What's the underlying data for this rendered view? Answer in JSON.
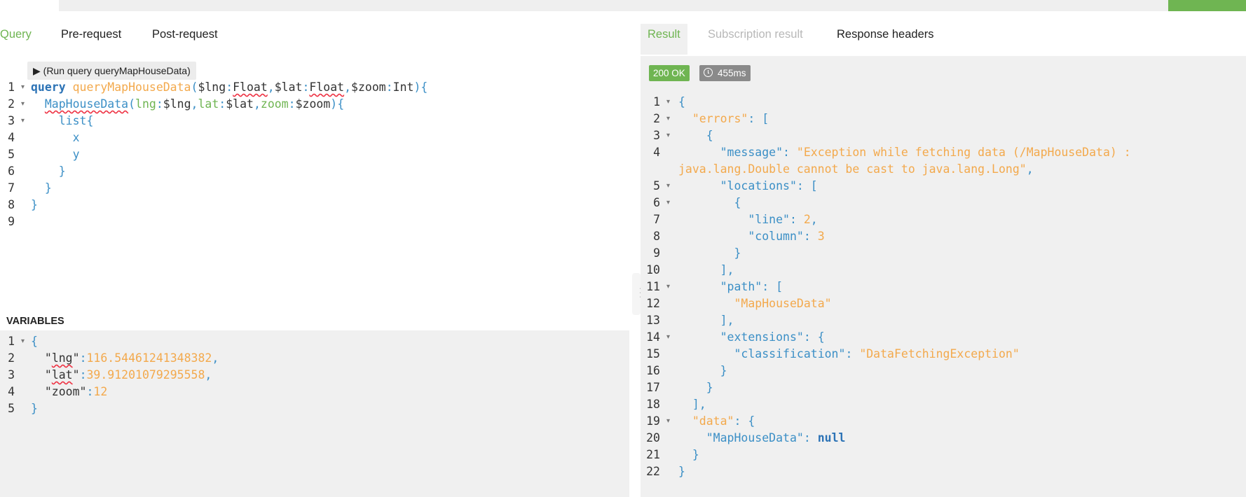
{
  "top_tabs": {
    "query": "Query",
    "pre_request": "Pre-request",
    "post_request": "Post-request"
  },
  "result_tabs": {
    "result": "Result",
    "subscription": "Subscription result",
    "headers": "Response headers"
  },
  "run_button": "▶ (Run query queryMapHouseData)",
  "variables_title": "VARIABLES",
  "status": {
    "code": "200 OK",
    "time": "455ms"
  },
  "colors": {
    "accent": "#6fb552",
    "keyword": "#2c73b6",
    "string": "#f3a94c",
    "key": "#3b8fc6"
  },
  "query_lines": [
    [
      {
        "t": "query",
        "c": "kw"
      },
      {
        "t": " ",
        "c": "var"
      },
      {
        "t": "queryMapHouseData",
        "c": "fn"
      },
      {
        "t": "(",
        "c": "punc"
      },
      {
        "t": "$lng",
        "c": "var"
      },
      {
        "t": ":",
        "c": "punc"
      },
      {
        "t": "Float",
        "c": "var",
        "sq": true
      },
      {
        "t": ",",
        "c": "punc"
      },
      {
        "t": "$lat",
        "c": "var"
      },
      {
        "t": ":",
        "c": "punc"
      },
      {
        "t": "Float",
        "c": "var",
        "sq": true
      },
      {
        "t": ",",
        "c": "punc"
      },
      {
        "t": "$zoom",
        "c": "var"
      },
      {
        "t": ":",
        "c": "punc"
      },
      {
        "t": "Int",
        "c": "var"
      },
      {
        "t": "){",
        "c": "punc"
      }
    ],
    [
      {
        "t": "  ",
        "c": "var"
      },
      {
        "t": "MapHouseData",
        "c": "fld",
        "sq": true
      },
      {
        "t": "(",
        "c": "punc"
      },
      {
        "t": "lng",
        "c": "arg"
      },
      {
        "t": ":",
        "c": "punc"
      },
      {
        "t": "$lng",
        "c": "var"
      },
      {
        "t": ",",
        "c": "punc"
      },
      {
        "t": "lat",
        "c": "arg"
      },
      {
        "t": ":",
        "c": "punc"
      },
      {
        "t": "$lat",
        "c": "var"
      },
      {
        "t": ",",
        "c": "punc"
      },
      {
        "t": "zoom",
        "c": "arg"
      },
      {
        "t": ":",
        "c": "punc"
      },
      {
        "t": "$zoom",
        "c": "var"
      },
      {
        "t": "){",
        "c": "punc"
      }
    ],
    [
      {
        "t": "    ",
        "c": "var"
      },
      {
        "t": "list",
        "c": "fld"
      },
      {
        "t": "{",
        "c": "punc"
      }
    ],
    [
      {
        "t": "      ",
        "c": "var"
      },
      {
        "t": "x",
        "c": "fld"
      }
    ],
    [
      {
        "t": "      ",
        "c": "var"
      },
      {
        "t": "y",
        "c": "fld"
      }
    ],
    [
      {
        "t": "    ",
        "c": "var"
      },
      {
        "t": "}",
        "c": "punc"
      }
    ],
    [
      {
        "t": "  ",
        "c": "var"
      },
      {
        "t": "}",
        "c": "punc"
      }
    ],
    [
      {
        "t": "}",
        "c": "punc"
      }
    ],
    []
  ],
  "query_folds": [
    1,
    2,
    3
  ],
  "variable_lines": [
    [
      {
        "t": "{",
        "c": "punc"
      }
    ],
    [
      {
        "t": "  ",
        "c": "var"
      },
      {
        "t": "\"",
        "c": "var"
      },
      {
        "t": "lng",
        "c": "var",
        "sq": true
      },
      {
        "t": "\"",
        "c": "var"
      },
      {
        "t": ":",
        "c": "punc"
      },
      {
        "t": "116.54461241348382",
        "c": "num"
      },
      {
        "t": ",",
        "c": "punc"
      }
    ],
    [
      {
        "t": "  ",
        "c": "var"
      },
      {
        "t": "\"",
        "c": "var"
      },
      {
        "t": "lat",
        "c": "var",
        "sq": true
      },
      {
        "t": "\"",
        "c": "var"
      },
      {
        "t": ":",
        "c": "punc"
      },
      {
        "t": "39.91201079295558",
        "c": "num"
      },
      {
        "t": ",",
        "c": "punc"
      }
    ],
    [
      {
        "t": "  ",
        "c": "var"
      },
      {
        "t": "\"zoom\"",
        "c": "var"
      },
      {
        "t": ":",
        "c": "punc"
      },
      {
        "t": "12",
        "c": "num"
      }
    ],
    [
      {
        "t": "}",
        "c": "punc"
      }
    ]
  ],
  "variable_folds": [
    1
  ],
  "result_lines": [
    {
      "n": "1",
      "parts": [
        {
          "t": "{",
          "c": "punc"
        }
      ]
    },
    {
      "n": "2",
      "parts": [
        {
          "t": "  ",
          "c": "var"
        },
        {
          "t": "\"errors\"",
          "c": "str"
        },
        {
          "t": ": [",
          "c": "punc"
        }
      ]
    },
    {
      "n": "3",
      "parts": [
        {
          "t": "    ",
          "c": "var"
        },
        {
          "t": "{",
          "c": "punc"
        }
      ]
    },
    {
      "n": "4",
      "parts": [
        {
          "t": "      ",
          "c": "var"
        },
        {
          "t": "\"message\"",
          "c": "key"
        },
        {
          "t": ": ",
          "c": "punc"
        },
        {
          "t": "\"Exception while fetching data (/MapHouseData) :",
          "c": "str"
        }
      ]
    },
    {
      "n": "",
      "parts": [
        {
          "t": "java.lang.Double cannot be cast to java.lang.Long\"",
          "c": "str"
        },
        {
          "t": ",",
          "c": "punc"
        }
      ]
    },
    {
      "n": "5",
      "parts": [
        {
          "t": "      ",
          "c": "var"
        },
        {
          "t": "\"locations\"",
          "c": "key"
        },
        {
          "t": ": [",
          "c": "punc"
        }
      ]
    },
    {
      "n": "6",
      "parts": [
        {
          "t": "        ",
          "c": "var"
        },
        {
          "t": "{",
          "c": "punc"
        }
      ]
    },
    {
      "n": "7",
      "parts": [
        {
          "t": "          ",
          "c": "var"
        },
        {
          "t": "\"line\"",
          "c": "key"
        },
        {
          "t": ": ",
          "c": "punc"
        },
        {
          "t": "2",
          "c": "num"
        },
        {
          "t": ",",
          "c": "punc"
        }
      ]
    },
    {
      "n": "8",
      "parts": [
        {
          "t": "          ",
          "c": "var"
        },
        {
          "t": "\"column\"",
          "c": "key"
        },
        {
          "t": ": ",
          "c": "punc"
        },
        {
          "t": "3",
          "c": "num"
        }
      ]
    },
    {
      "n": "9",
      "parts": [
        {
          "t": "        ",
          "c": "var"
        },
        {
          "t": "}",
          "c": "punc"
        }
      ]
    },
    {
      "n": "10",
      "parts": [
        {
          "t": "      ",
          "c": "var"
        },
        {
          "t": "],",
          "c": "punc"
        }
      ]
    },
    {
      "n": "11",
      "parts": [
        {
          "t": "      ",
          "c": "var"
        },
        {
          "t": "\"path\"",
          "c": "key"
        },
        {
          "t": ": [",
          "c": "punc"
        }
      ]
    },
    {
      "n": "12",
      "parts": [
        {
          "t": "        ",
          "c": "var"
        },
        {
          "t": "\"MapHouseData\"",
          "c": "str"
        }
      ]
    },
    {
      "n": "13",
      "parts": [
        {
          "t": "      ",
          "c": "var"
        },
        {
          "t": "],",
          "c": "punc"
        }
      ]
    },
    {
      "n": "14",
      "parts": [
        {
          "t": "      ",
          "c": "var"
        },
        {
          "t": "\"extensions\"",
          "c": "key"
        },
        {
          "t": ": {",
          "c": "punc"
        }
      ]
    },
    {
      "n": "15",
      "parts": [
        {
          "t": "        ",
          "c": "var"
        },
        {
          "t": "\"classification\"",
          "c": "key"
        },
        {
          "t": ": ",
          "c": "punc"
        },
        {
          "t": "\"DataFetchingException\"",
          "c": "str"
        }
      ]
    },
    {
      "n": "16",
      "parts": [
        {
          "t": "      ",
          "c": "var"
        },
        {
          "t": "}",
          "c": "punc"
        }
      ]
    },
    {
      "n": "17",
      "parts": [
        {
          "t": "    ",
          "c": "var"
        },
        {
          "t": "}",
          "c": "punc"
        }
      ]
    },
    {
      "n": "18",
      "parts": [
        {
          "t": "  ",
          "c": "var"
        },
        {
          "t": "],",
          "c": "punc"
        }
      ]
    },
    {
      "n": "19",
      "parts": [
        {
          "t": "  ",
          "c": "var"
        },
        {
          "t": "\"data\"",
          "c": "str"
        },
        {
          "t": ": {",
          "c": "punc"
        }
      ]
    },
    {
      "n": "20",
      "parts": [
        {
          "t": "    ",
          "c": "var"
        },
        {
          "t": "\"MapHouseData\"",
          "c": "key"
        },
        {
          "t": ": ",
          "c": "punc"
        },
        {
          "t": "null",
          "c": "nul"
        }
      ]
    },
    {
      "n": "21",
      "parts": [
        {
          "t": "  ",
          "c": "var"
        },
        {
          "t": "}",
          "c": "punc"
        }
      ]
    },
    {
      "n": "22",
      "parts": [
        {
          "t": "}",
          "c": "punc"
        }
      ]
    }
  ],
  "result_folds": [
    "1",
    "2",
    "3",
    "5",
    "6",
    "11",
    "14",
    "19"
  ]
}
